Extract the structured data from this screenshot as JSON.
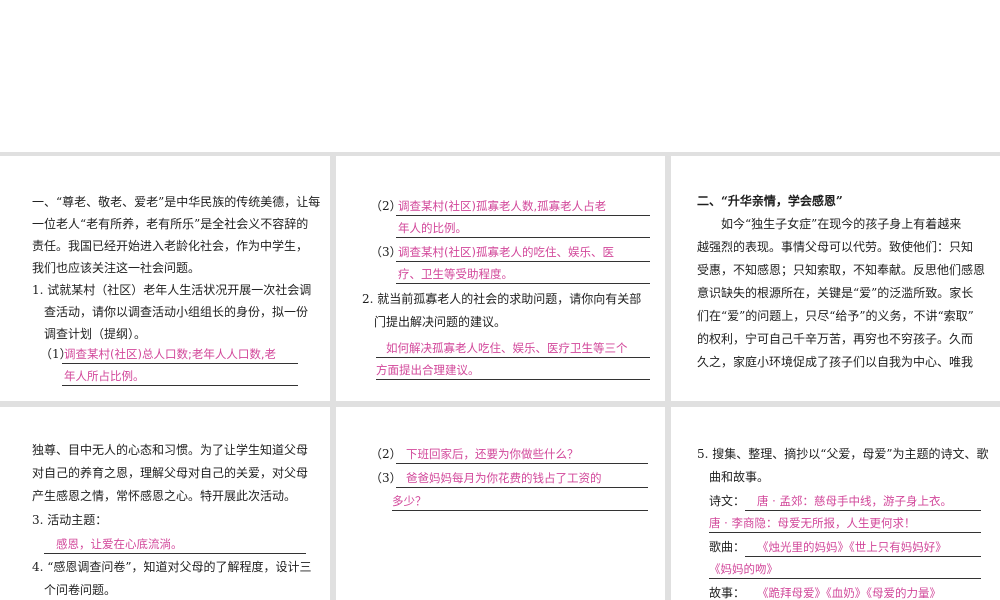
{
  "panel1": {
    "intro": [
      "一、“尊老、敬老、爱老”是中华民族的传统美德，让每",
      "一位老人“老有所养，老有所乐”是全社会义不容辞的",
      "责任。我国已经开始进入老龄化社会，作为中学生，",
      "我们也应该关注这一社会问题。"
    ],
    "q1": [
      "1. 试就某村（社区）老年人生活状况开展一次社会调",
      "查活动，请你以调查活动小组组长的身份，拟一份",
      "调查计划（提纲）。"
    ],
    "item1_label": "（1）",
    "item1_answer": [
      "调查某村(社区)总人口数;老年人人口数,老",
      "年人所占比例。"
    ]
  },
  "panel2": {
    "item2_label": "（2）",
    "item2_answer": [
      "调查某村(社区)孤寡老人数,孤寡老人占老",
      "年人的比例。"
    ],
    "item3_label": "（3）",
    "item3_answer": [
      "调查某村(社区)孤寡老人的吃住、娱乐、医",
      "疗、卫生等受助程度。"
    ],
    "q2": [
      "2. 就当前孤寡老人的社会的求助问题，请你向有关部",
      "门提出解决问题的建议。"
    ],
    "q2_answer": [
      "如何解决孤寡老人吃住、娱乐、医疗卫生等三个",
      "方面提出合理建议。"
    ]
  },
  "panel3": {
    "heading": "二、“升华亲情，学会感恩”",
    "body": [
      "如今“独生子女症”在现今的孩子身上有着越来",
      "越强烈的表现。事情父母可以代劳。致使他们：只知",
      "受惠，不知感恩；只知索取，不知奉献。反思他们感恩",
      "意识缺失的根源所在，关键是“爱”的泛滥所致。家长",
      "们在“爱”的问题上，只尽“给予”的义务，不讲“索取”",
      "的权利，宁可自己千辛万苦，再穷也不穷孩子。久而",
      "久之，家庭小环境促成了孩子们以自我为中心、唯我"
    ]
  },
  "panel4": {
    "body": [
      "独尊、目中无人的心态和习惯。为了让学生知道父母",
      "对自己的养育之恩，理解父母对自己的关爱，对父母",
      "产生感恩之情，常怀感恩之心。特开展此次活动。"
    ],
    "q3": "3. 活动主题：",
    "q3_answer": "感恩，让爱在心底流淌。",
    "q4": [
      "4. “感恩调查问卷”，知道对父母的了解程度，设计三",
      "个问卷问题。"
    ]
  },
  "panel5": {
    "item2_label": "（2）",
    "item2_answer": "下班回家后，还要为你做些什么？",
    "item3_label": "（3）",
    "item3_answer": [
      "爸爸妈妈每月为你花费的钱占了工资的",
      "多少？"
    ]
  },
  "panel6": {
    "q5": [
      "5. 搜集、整理、摘抄以“父爱，母爱”为主题的诗文、歌",
      "曲和故事。"
    ],
    "poem_label": "诗文：",
    "poem_answer": [
      "唐 · 孟郊：慈母手中线，游子身上衣。",
      "唐 · 李商隐：母爱无所报，人生更何求！"
    ],
    "song_label": "歌曲：",
    "song_answer": [
      "《烛光里的妈妈》《世上只有妈妈好》",
      "《妈妈的吻》"
    ],
    "story_label": "故事：",
    "story_answer": "《跪拜母爱》《血奶》《母爱的力量》"
  }
}
